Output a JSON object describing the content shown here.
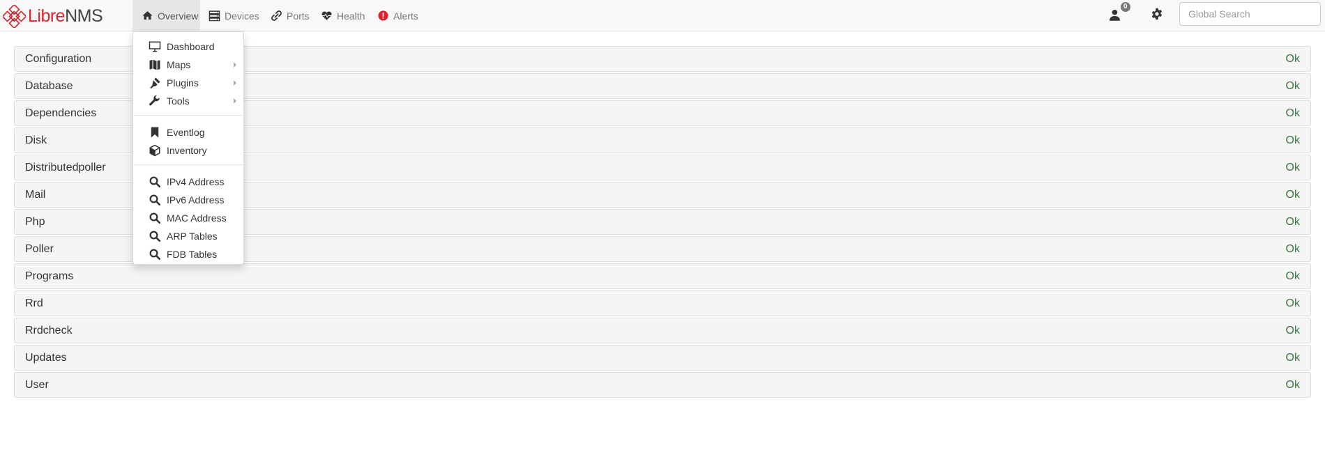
{
  "brand": {
    "part1": "Libre",
    "part2": "NMS"
  },
  "nav": {
    "overview": "Overview",
    "devices": "Devices",
    "ports": "Ports",
    "health": "Health",
    "alerts": "Alerts"
  },
  "user": {
    "notification_count": "0"
  },
  "search": {
    "placeholder": "Global Search"
  },
  "menu": {
    "items": [
      {
        "label": "Dashboard",
        "icon": "monitor-icon"
      },
      {
        "label": "Maps",
        "icon": "map-icon",
        "submenu": true
      },
      {
        "label": "Plugins",
        "icon": "plug-icon",
        "submenu": true
      },
      {
        "label": "Tools",
        "icon": "wrench-icon",
        "submenu": true
      },
      {
        "label": "Eventlog",
        "icon": "bookmark-icon"
      },
      {
        "label": "Inventory",
        "icon": "cube-icon"
      },
      {
        "label": "IPv4 Address",
        "icon": "search-icon"
      },
      {
        "label": "IPv6 Address",
        "icon": "search-icon"
      },
      {
        "label": "MAC Address",
        "icon": "search-icon"
      },
      {
        "label": "ARP Tables",
        "icon": "search-icon"
      },
      {
        "label": "FDB Tables",
        "icon": "search-icon"
      }
    ]
  },
  "checks": [
    {
      "name": "Configuration",
      "status": "Ok"
    },
    {
      "name": "Database",
      "status": "Ok"
    },
    {
      "name": "Dependencies",
      "status": "Ok"
    },
    {
      "name": "Disk",
      "status": "Ok"
    },
    {
      "name": "Distributedpoller",
      "status": "Ok"
    },
    {
      "name": "Mail",
      "status": "Ok"
    },
    {
      "name": "Php",
      "status": "Ok"
    },
    {
      "name": "Poller",
      "status": "Ok"
    },
    {
      "name": "Programs",
      "status": "Ok"
    },
    {
      "name": "Rrd",
      "status": "Ok"
    },
    {
      "name": "Rrdcheck",
      "status": "Ok"
    },
    {
      "name": "Updates",
      "status": "Ok"
    },
    {
      "name": "User",
      "status": "Ok"
    }
  ],
  "colors": {
    "brand_red": "#d9232d",
    "ok_green": "#3c763d",
    "navbar_bg": "#f8f8f8"
  }
}
